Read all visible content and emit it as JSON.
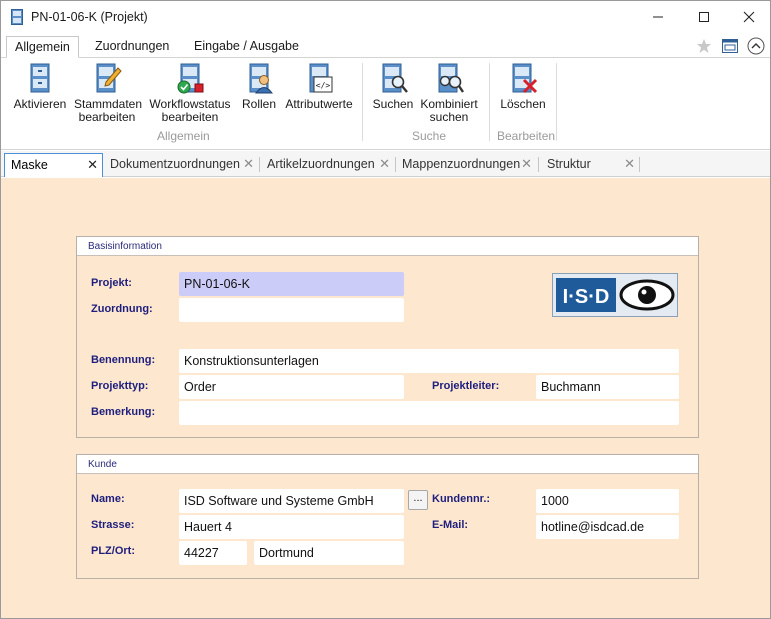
{
  "window": {
    "title": "PN-01-06-K (Projekt)"
  },
  "ribbon_tabs": [
    "Allgemein",
    "Zuordnungen",
    "Eingabe / Ausgabe"
  ],
  "ribbon": {
    "groups": [
      {
        "label": "Allgemein",
        "buttons": [
          "Aktivieren",
          "Stammdaten\nbearbeiten",
          "Workflowstatus\nbearbeiten",
          "Rollen",
          "Attributwerte"
        ]
      },
      {
        "label": "Suche",
        "buttons": [
          "Suchen",
          "Kombiniert\nsuchen"
        ]
      },
      {
        "label": "Bearbeiten",
        "buttons": [
          "Löschen"
        ]
      }
    ]
  },
  "doc_tabs": [
    "Maske",
    "Dokumentzuordnungen",
    "Artikelzuordnungen",
    "Mappenzuordnungen",
    "Struktur"
  ],
  "basis": {
    "header": "Basisinformation",
    "projekt_label": "Projekt:",
    "projekt_value": "PN-01-06-K",
    "zuordnung_label": "Zuordnung:",
    "zuordnung_value": "",
    "benennung_label": "Benennung:",
    "benennung_value": "Konstruktionsunterlagen",
    "projekttyp_label": "Projekttyp:",
    "projekttyp_value": "Order",
    "projektleiter_label": "Projektleiter:",
    "projektleiter_value": "Buchmann",
    "bemerkung_label": "Bemerkung:",
    "bemerkung_value": "",
    "logo_text": "I·S·D"
  },
  "kunde": {
    "header": "Kunde",
    "name_label": "Name:",
    "name_value": "ISD Software und Systeme GmbH",
    "browse_label": "...",
    "kundennr_label": "Kundennr.:",
    "kundennr_value": "1000",
    "strasse_label": "Strasse:",
    "strasse_value": "Hauert 4",
    "email_label": "E-Mail:",
    "email_value": "hotline@isdcad.de",
    "plzort_label": "PLZ/Ort:",
    "plz_value": "44227",
    "ort_value": "Dortmund"
  },
  "colors": {
    "field_highlight": "#ccccf8",
    "form_bg": "#fde8cf",
    "label": "#1e1e7e",
    "tab_accent": "#4a8fd8"
  },
  "icons": [
    "file-cabinet-icon",
    "pencil-icon",
    "workflow-icon",
    "user-role-icon",
    "code-attribute-icon",
    "search-icon",
    "combined-search-icon",
    "delete-icon",
    "star-icon",
    "window-icon",
    "collapse-ribbon-icon"
  ]
}
